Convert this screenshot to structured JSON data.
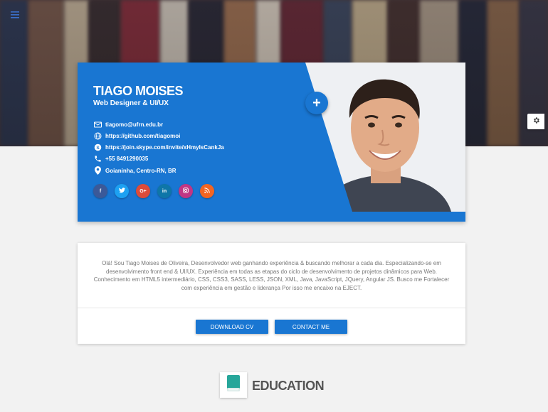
{
  "profile": {
    "name": "TIAGO MOISES",
    "role": "Web Designer & UI/UX",
    "contacts": [
      {
        "icon": "email-icon",
        "text": "tiagomo@ufrn.edu.br"
      },
      {
        "icon": "globe-icon",
        "text": "https://github.com/tiagomoi"
      },
      {
        "icon": "skype-icon",
        "text": "https://join.skype.com/invite/xHmyIsCankJa"
      },
      {
        "icon": "phone-icon",
        "text": "+55 8491290035"
      },
      {
        "icon": "location-icon",
        "text": "Goianinha, Centro-RN, BR"
      }
    ],
    "socials": [
      {
        "name": "facebook",
        "glyph": "f",
        "color": "#3b5998"
      },
      {
        "name": "twitter",
        "glyph": "t",
        "color": "#1da1f2"
      },
      {
        "name": "google-plus",
        "glyph": "G+",
        "color": "#dd4b39"
      },
      {
        "name": "linkedin",
        "glyph": "in",
        "color": "#0e76a8"
      },
      {
        "name": "instagram",
        "glyph": "ig",
        "color": "#c13584"
      },
      {
        "name": "rss",
        "glyph": "rss",
        "color": "#f26522"
      }
    ],
    "fab_label": "+"
  },
  "about": {
    "text": "Olá! Sou Tiago Moises de Oliveira, Desenvolvedor web ganhando experiência & buscando melhorar a cada dia. Especializando-se em desenvolvimento front end & UI/UX. Experiência em todas as etapas do ciclo de desenvolvimento de projetos dinâmicos para Web. Conhecimento em HTML5 intermediário, CSS, CSS3, SASS, LESS, JSON, XML, Java, JavaScript, JQuery, Angular JS. Busco me Fortalecer com experiência em gestão e liderança Por isso me encaixo na EJECT.",
    "download_label": "DOWNLOAD CV",
    "contact_label": "CONTACT ME"
  },
  "education": {
    "title": "EDUCATION",
    "icon": "book-icon"
  },
  "colors": {
    "primary": "#1976d2",
    "education_icon": "#26a69a"
  }
}
